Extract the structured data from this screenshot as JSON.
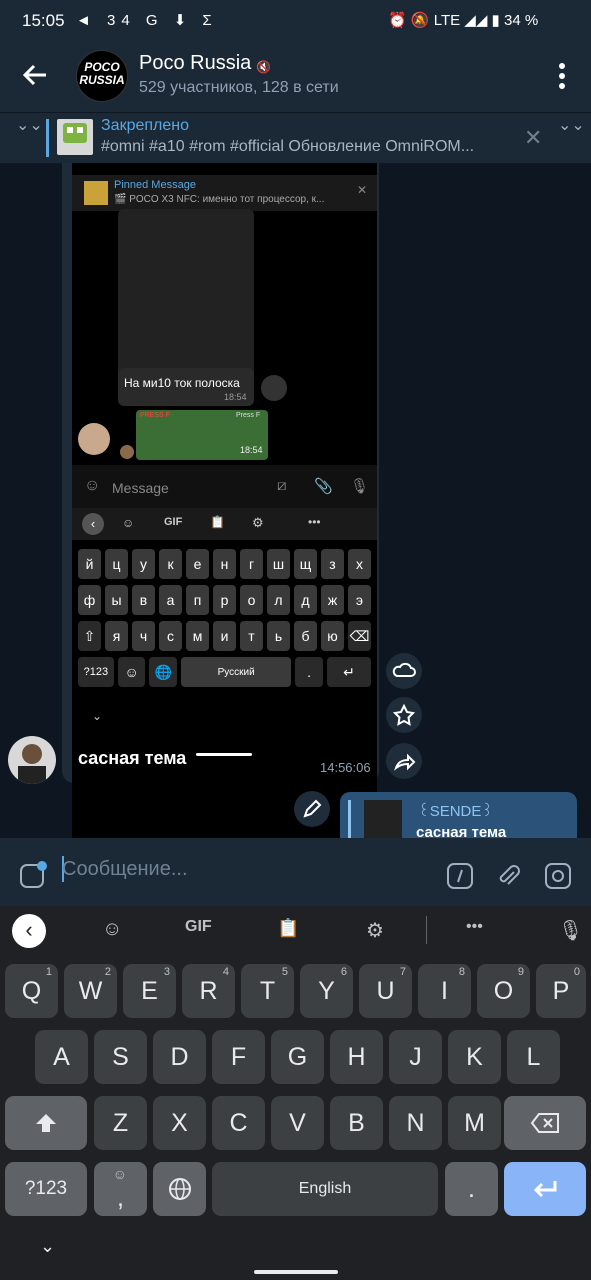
{
  "status_bar": {
    "time": "15:05",
    "left_icons": "◄ 34 G ⬇ Σ",
    "network": "LTE",
    "battery": "34 %"
  },
  "header": {
    "title": "Poco Russia",
    "subtitle": "529 участников, 128 в сети",
    "avatar_text": [
      "POCO",
      "RUSSIA"
    ]
  },
  "pinned": {
    "label": "Закреплено",
    "text": "#omni #a10 #rom #official Обновление OmniROM..."
  },
  "screenshot": {
    "pinned_title": "Pinned Message",
    "pinned_text": "🎬 POCO X3 NFC: именно тот процессор, к...",
    "bubble_text": "На ми10 ток полоска",
    "bubble_time": "18:54",
    "sticker_time": "18:54",
    "sticker_label_left": "PRESS F",
    "sticker_label_right": "Press F",
    "input_placeholder": "Message",
    "kb_row1": [
      "й",
      "ц",
      "у",
      "к",
      "е",
      "н",
      "г",
      "ш",
      "щ",
      "з",
      "х"
    ],
    "kb_row2": [
      "ф",
      "ы",
      "в",
      "а",
      "п",
      "р",
      "о",
      "л",
      "д",
      "ж",
      "э"
    ],
    "kb_row3": [
      "я",
      "ч",
      "с",
      "м",
      "и",
      "т",
      "ь",
      "б",
      "ю"
    ],
    "kb_mode": "?123",
    "kb_space": "Русский",
    "kb_dot": "."
  },
  "message": {
    "caption": "сасная тема",
    "time": "14:56:06"
  },
  "reply": {
    "name": "꒰SENDE꒱",
    "text": "сасная тема"
  },
  "input": {
    "placeholder": "Сообщение..."
  },
  "keyboard": {
    "row1": [
      {
        "k": "Q",
        "h": "1"
      },
      {
        "k": "W",
        "h": "2"
      },
      {
        "k": "E",
        "h": "3"
      },
      {
        "k": "R",
        "h": "4"
      },
      {
        "k": "T",
        "h": "5"
      },
      {
        "k": "Y",
        "h": "6"
      },
      {
        "k": "U",
        "h": "7"
      },
      {
        "k": "I",
        "h": "8"
      },
      {
        "k": "O",
        "h": "9"
      },
      {
        "k": "P",
        "h": "0"
      }
    ],
    "row2": [
      "A",
      "S",
      "D",
      "F",
      "G",
      "H",
      "J",
      "K",
      "L"
    ],
    "row3": [
      "Z",
      "X",
      "C",
      "V",
      "B",
      "N",
      "M"
    ],
    "mode": "?123",
    "comma": ",",
    "space": "English",
    "dot": ".",
    "gif": "GIF"
  }
}
